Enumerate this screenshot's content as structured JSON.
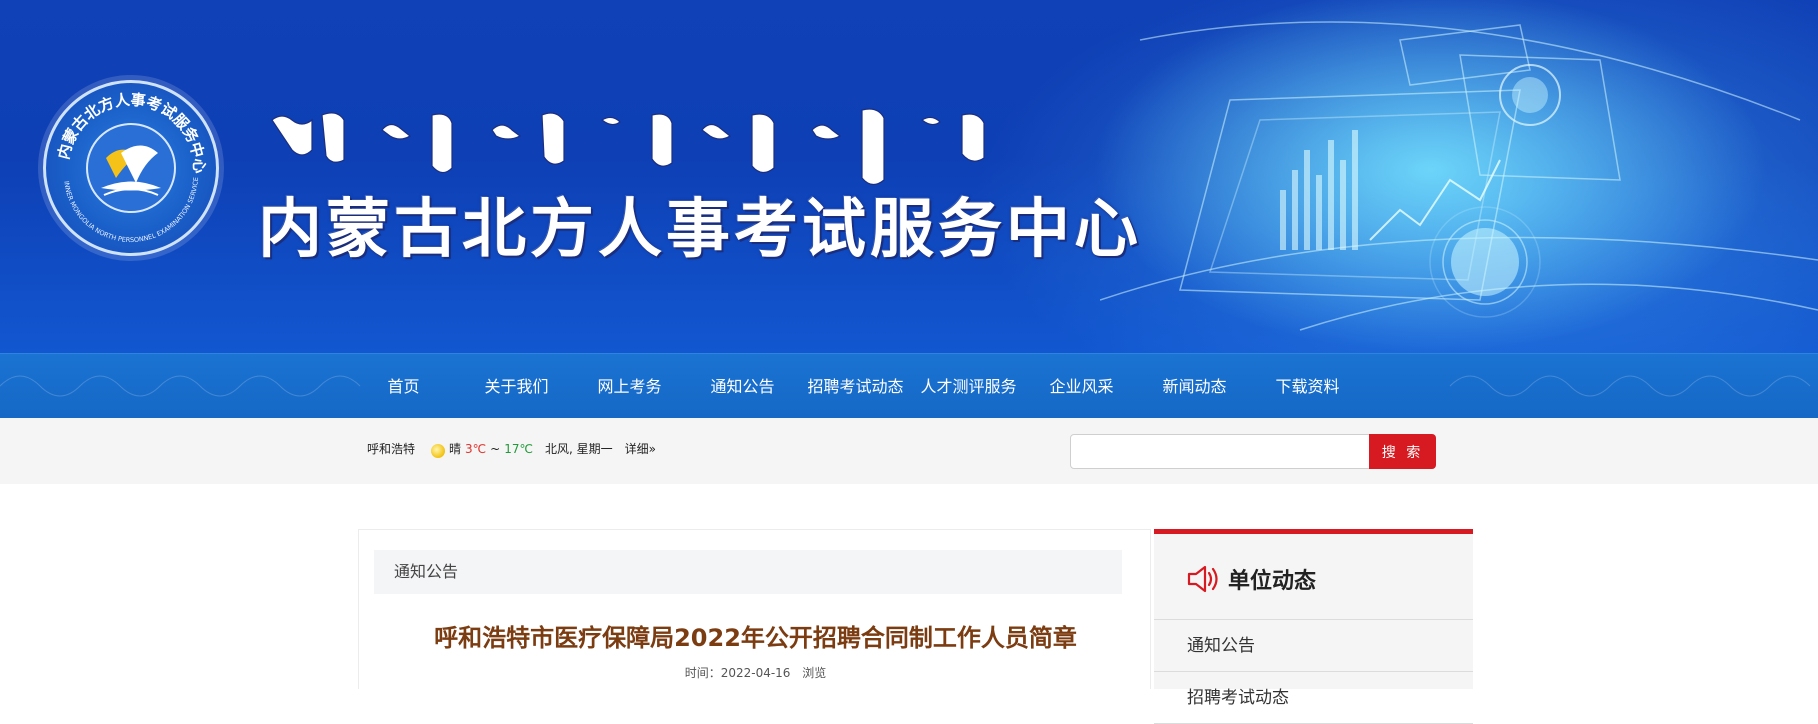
{
  "banner": {
    "site_title": "内蒙古北方人事考试服务中心",
    "logo_ring_text": "内蒙古北方人事考试服务中心",
    "logo_ring_text_en": "INNER MONGOLIA NORTH PERSONNEL EXAMINATION SERVICE CENTER"
  },
  "nav": {
    "items": [
      {
        "label": "首页"
      },
      {
        "label": "关于我们"
      },
      {
        "label": "网上考务"
      },
      {
        "label": "通知公告"
      },
      {
        "label": "招聘考试动态"
      },
      {
        "label": "人才测评服务"
      },
      {
        "label": "企业风采"
      },
      {
        "label": "新闻动态"
      },
      {
        "label": "下载资料"
      }
    ]
  },
  "weather": {
    "city": "呼和浩特",
    "icon": "sun-icon",
    "condition": "晴",
    "low": "3℃",
    "sep": "~",
    "high": "17℃",
    "wind_day": "北风, 星期一",
    "detail": "详细»"
  },
  "search": {
    "placeholder": "",
    "value": "",
    "button_label": "搜 索"
  },
  "main": {
    "breadcrumb": "通知公告",
    "article_title": "呼和浩特市医疗保障局2022年公开招聘合同制工作人员简章",
    "time_label": "时间：2022-04-16",
    "views_label": "浏览"
  },
  "sidebar": {
    "title": "单位动态",
    "icon": "speaker-icon",
    "items": [
      {
        "label": "通知公告"
      },
      {
        "label": "招聘考试动态"
      }
    ]
  },
  "colors": {
    "banner": "#0e3fb5",
    "nav": "#1568c6",
    "accent_red": "#d71a21",
    "title_brown": "#7b3c12"
  }
}
